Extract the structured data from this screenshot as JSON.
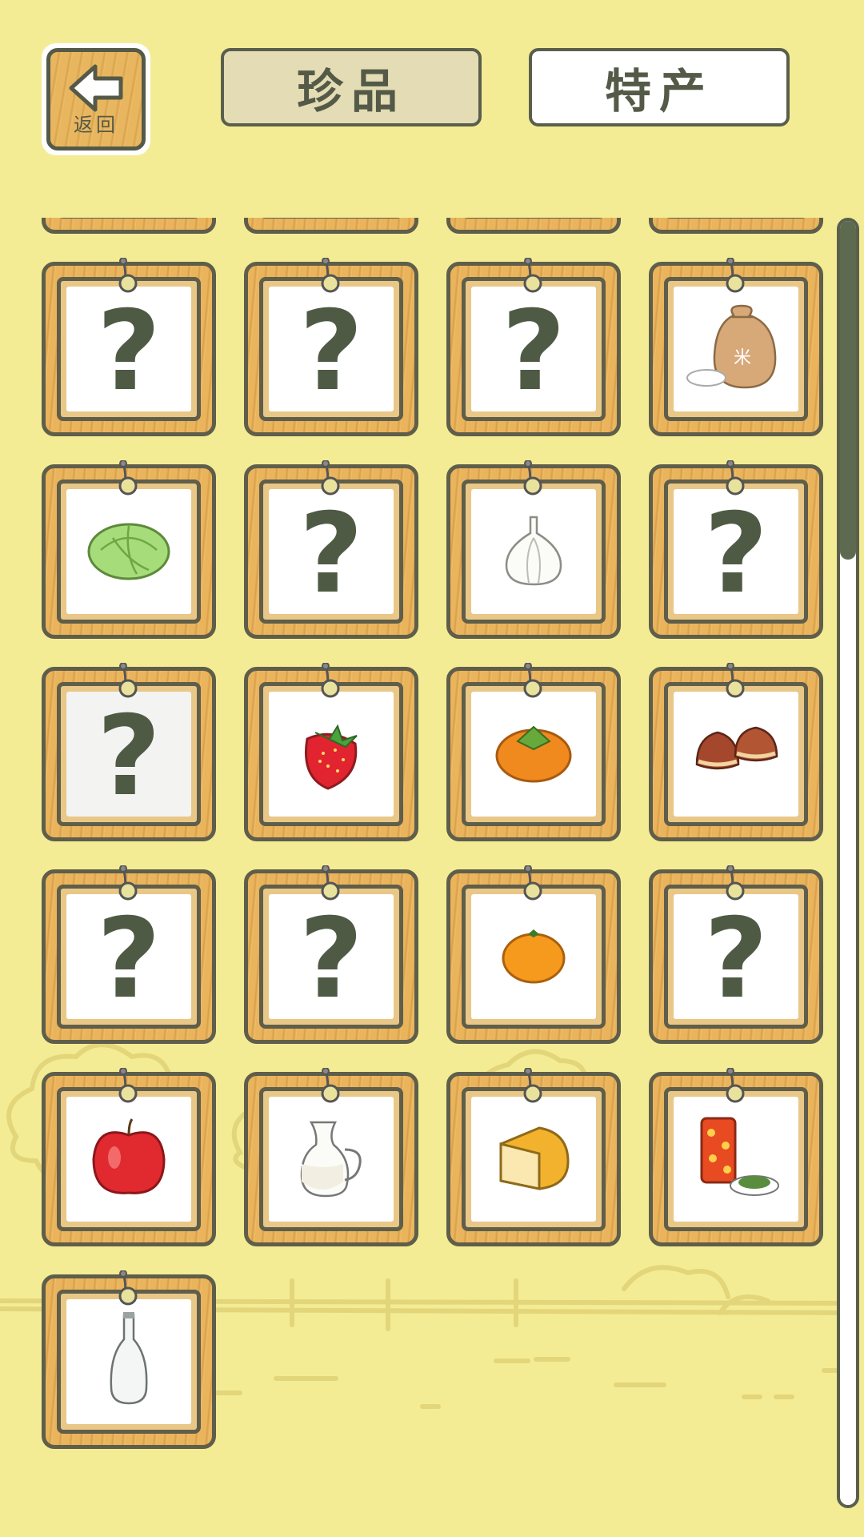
{
  "header": {
    "back_label": "返回",
    "tab_rare": "珍品",
    "tab_specialty": "特产"
  },
  "colors": {
    "background": "#f4ec94",
    "frame_wood": "#eab45c",
    "outline": "#5f5e4a",
    "question_mark": "#4f5a45",
    "tab_selected_bg": "#e3dcb4"
  },
  "scroll": {
    "position_fraction": 0.14,
    "visible_fraction": 0.19
  },
  "items": [
    {
      "icon": "tofu-icon",
      "unknown": false,
      "partial": true
    },
    {
      "icon": "question-mark-icon",
      "unknown": true,
      "partial": true
    },
    {
      "icon": "question-mark-icon",
      "unknown": true,
      "partial": true
    },
    {
      "icon": "onion-icon",
      "unknown": false,
      "partial": true
    },
    {
      "icon": "question-mark-icon",
      "unknown": true,
      "label": "?"
    },
    {
      "icon": "question-mark-icon",
      "unknown": true,
      "label": "?"
    },
    {
      "icon": "question-mark-icon",
      "unknown": true,
      "label": "?"
    },
    {
      "icon": "rice-sack-icon",
      "unknown": false
    },
    {
      "icon": "cabbage-icon",
      "unknown": false
    },
    {
      "icon": "question-mark-icon",
      "unknown": true,
      "label": "?"
    },
    {
      "icon": "garlic-icon",
      "unknown": false
    },
    {
      "icon": "question-mark-icon",
      "unknown": true,
      "label": "?"
    },
    {
      "icon": "question-mark-icon",
      "unknown": true,
      "label": "?",
      "dim": true
    },
    {
      "icon": "strawberry-icon",
      "unknown": false
    },
    {
      "icon": "persimmon-icon",
      "unknown": false
    },
    {
      "icon": "chestnut-icon",
      "unknown": false
    },
    {
      "icon": "question-mark-icon",
      "unknown": true,
      "label": "?"
    },
    {
      "icon": "question-mark-icon",
      "unknown": true,
      "label": "?"
    },
    {
      "icon": "mandarin-orange-icon",
      "unknown": false
    },
    {
      "icon": "question-mark-icon",
      "unknown": true,
      "label": "?"
    },
    {
      "icon": "apple-icon",
      "unknown": false
    },
    {
      "icon": "milk-jug-icon",
      "unknown": false
    },
    {
      "icon": "cheese-icon",
      "unknown": false
    },
    {
      "icon": "tea-can-icon",
      "unknown": false
    },
    {
      "icon": "glass-bottle-icon",
      "unknown": false
    }
  ]
}
